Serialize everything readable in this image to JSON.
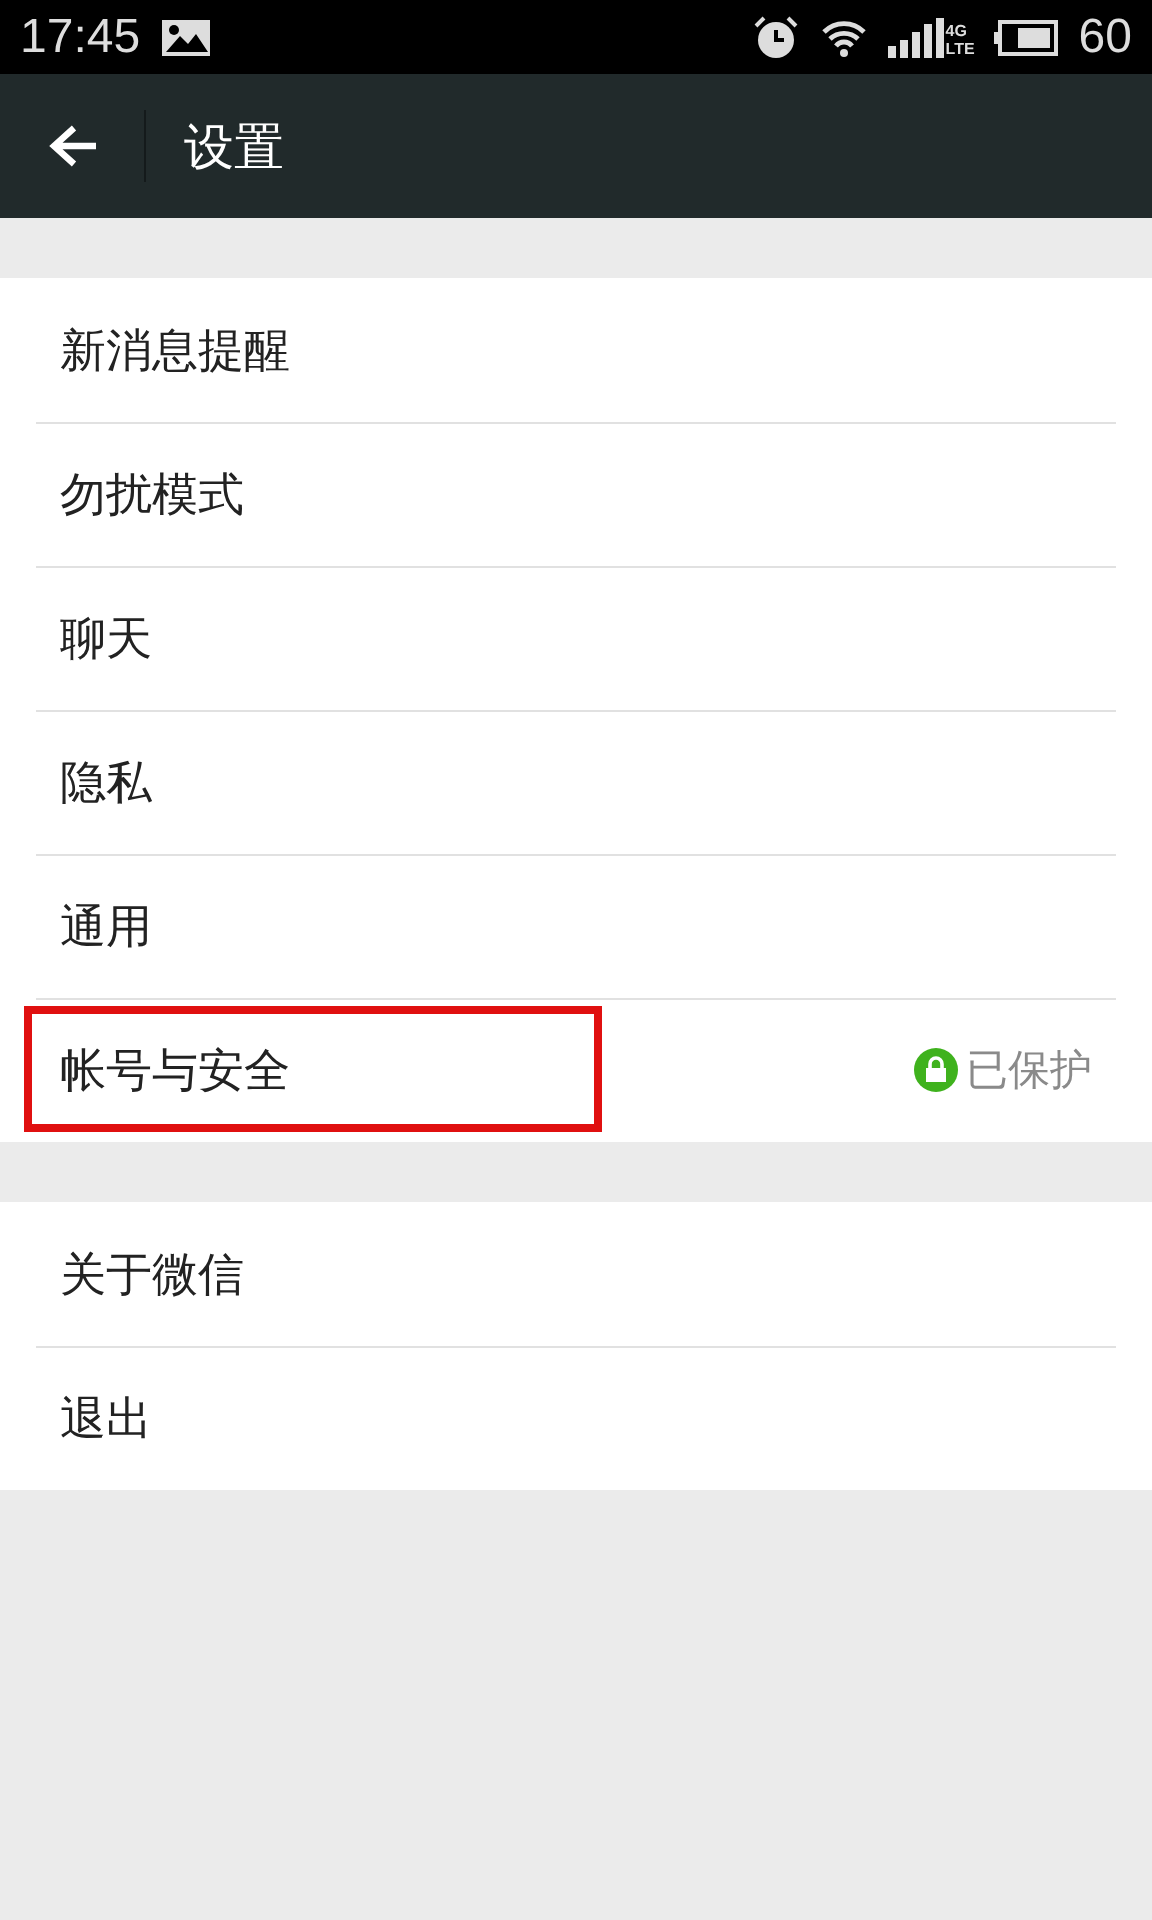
{
  "status_bar": {
    "time": "17:45",
    "network_top": "4G",
    "network_bottom": "LTE",
    "battery_text": "60"
  },
  "toolbar": {
    "title": "设置"
  },
  "groups": [
    {
      "items": [
        {
          "label": "新消息提醒",
          "highlighted": false
        },
        {
          "label": "勿扰模式",
          "highlighted": false
        },
        {
          "label": "聊天",
          "highlighted": false
        },
        {
          "label": "隐私",
          "highlighted": false
        },
        {
          "label": "通用",
          "highlighted": false
        },
        {
          "label": "帐号与安全",
          "highlighted": true,
          "status": "已保护"
        }
      ]
    },
    {
      "items": [
        {
          "label": "关于微信",
          "highlighted": false
        },
        {
          "label": "退出",
          "highlighted": false
        }
      ]
    }
  ]
}
